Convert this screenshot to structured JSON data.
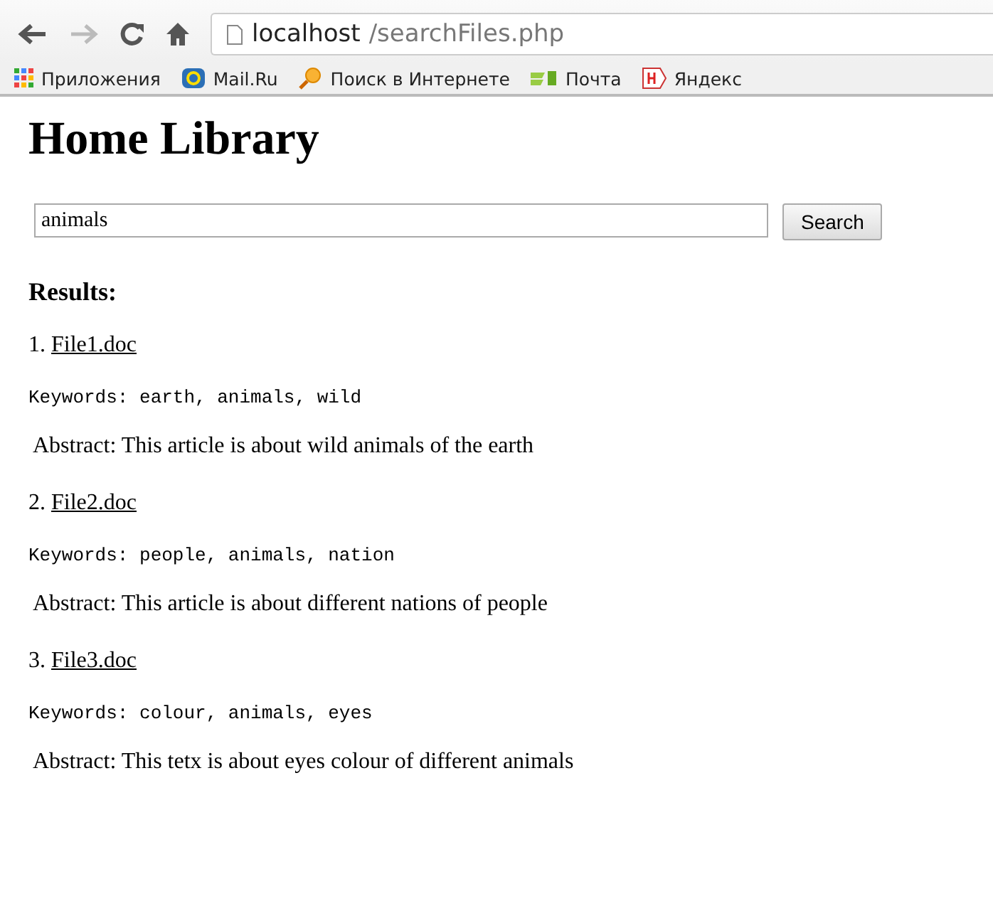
{
  "browser": {
    "url_host": "localhost",
    "url_path": "/searchFiles.php",
    "bookmarks": [
      {
        "label": "Приложения",
        "kind": "apps"
      },
      {
        "label": "Mail.Ru",
        "kind": "mail"
      },
      {
        "label": "Поиск в Интернете",
        "kind": "search"
      },
      {
        "label": "Почта",
        "kind": "post"
      },
      {
        "label": "Яндекс",
        "kind": "yandex"
      }
    ]
  },
  "page": {
    "title": "Home Library",
    "search": {
      "value": "animals",
      "button": "Search"
    },
    "results_heading": "Results:",
    "results": [
      {
        "number": "1.",
        "file": "File1.doc",
        "keywords": "Keywords: earth, animals, wild",
        "abstract": "Abstract: This article is about wild animals of the earth"
      },
      {
        "number": "2.",
        "file": "File2.doc",
        "keywords": "Keywords: people, animals, nation",
        "abstract": "Abstract: This article is about different nations of people"
      },
      {
        "number": "3.",
        "file": "File3.doc",
        "keywords": "Keywords: colour, animals, eyes",
        "abstract": "Abstract: This tetx is about eyes colour of different animals"
      }
    ]
  }
}
